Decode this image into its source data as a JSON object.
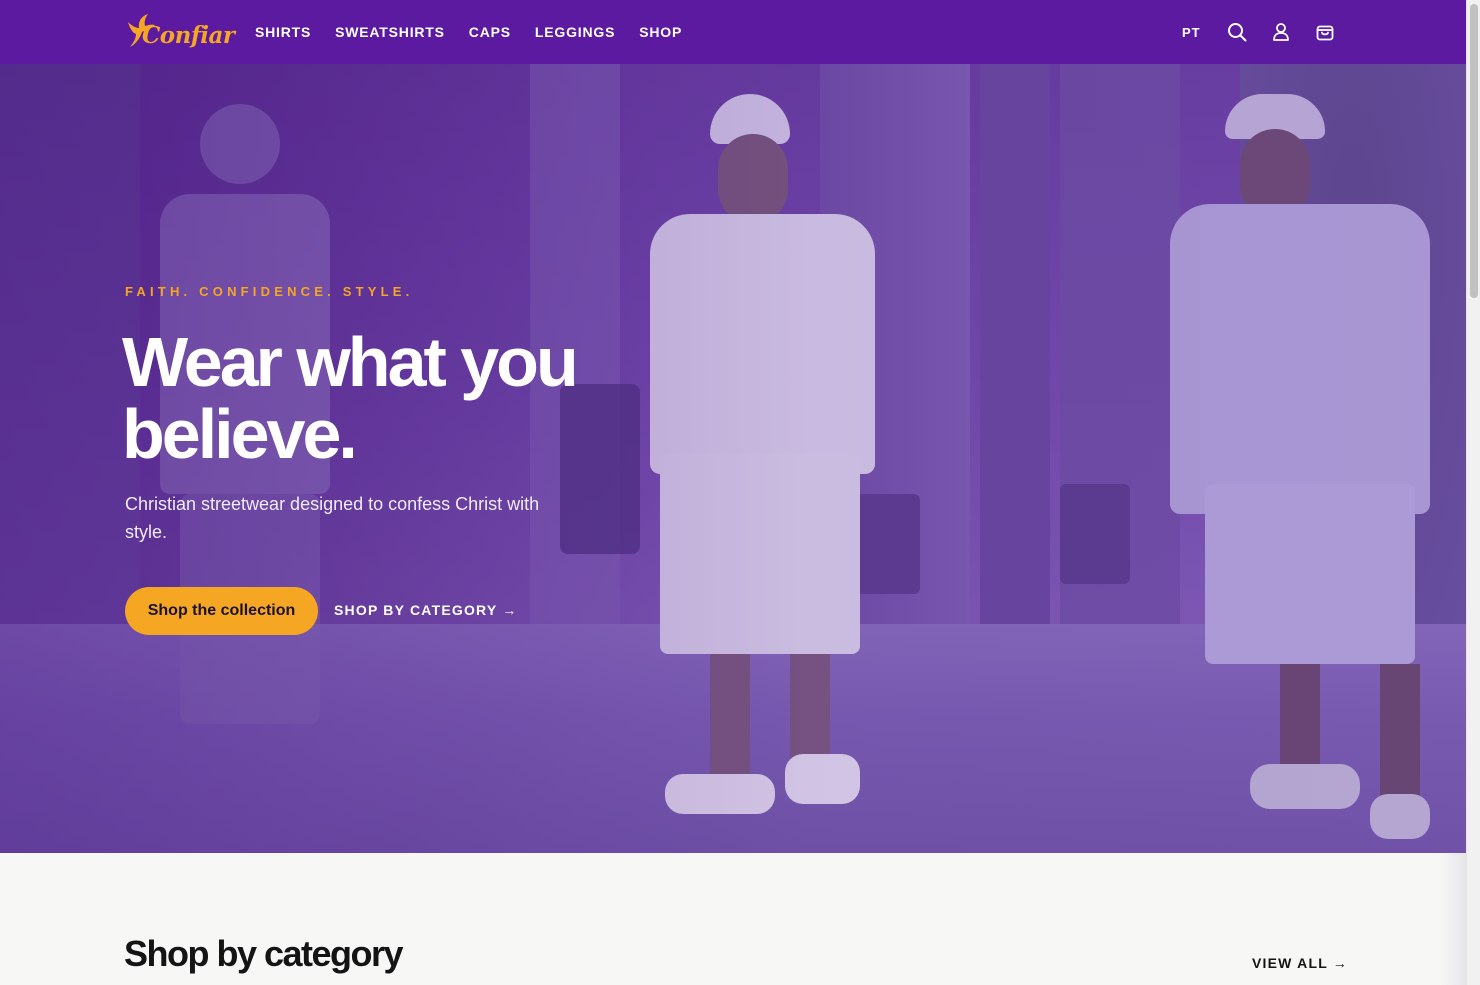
{
  "brand": {
    "name": "Confiar",
    "color_primary": "#5b1aa0",
    "color_accent": "#f5a623"
  },
  "nav": {
    "items": [
      "SHIRTS",
      "SWEATSHIRTS",
      "CAPS",
      "LEGGINGS",
      "SHOP"
    ]
  },
  "header": {
    "lang": "PT",
    "icons": [
      "search-icon",
      "account-icon",
      "cart-icon"
    ]
  },
  "hero": {
    "eyebrow": "FAITH. CONFIDENCE. STYLE.",
    "headline": "Wear what you believe.",
    "subtitle": "Christian streetwear designed to confess Christ with style.",
    "primary_cta": "Shop the collection",
    "secondary_cta": "SHOP BY CATEGORY →"
  },
  "category_section": {
    "title": "Shop by category",
    "view_all": "VIEW ALL →"
  }
}
